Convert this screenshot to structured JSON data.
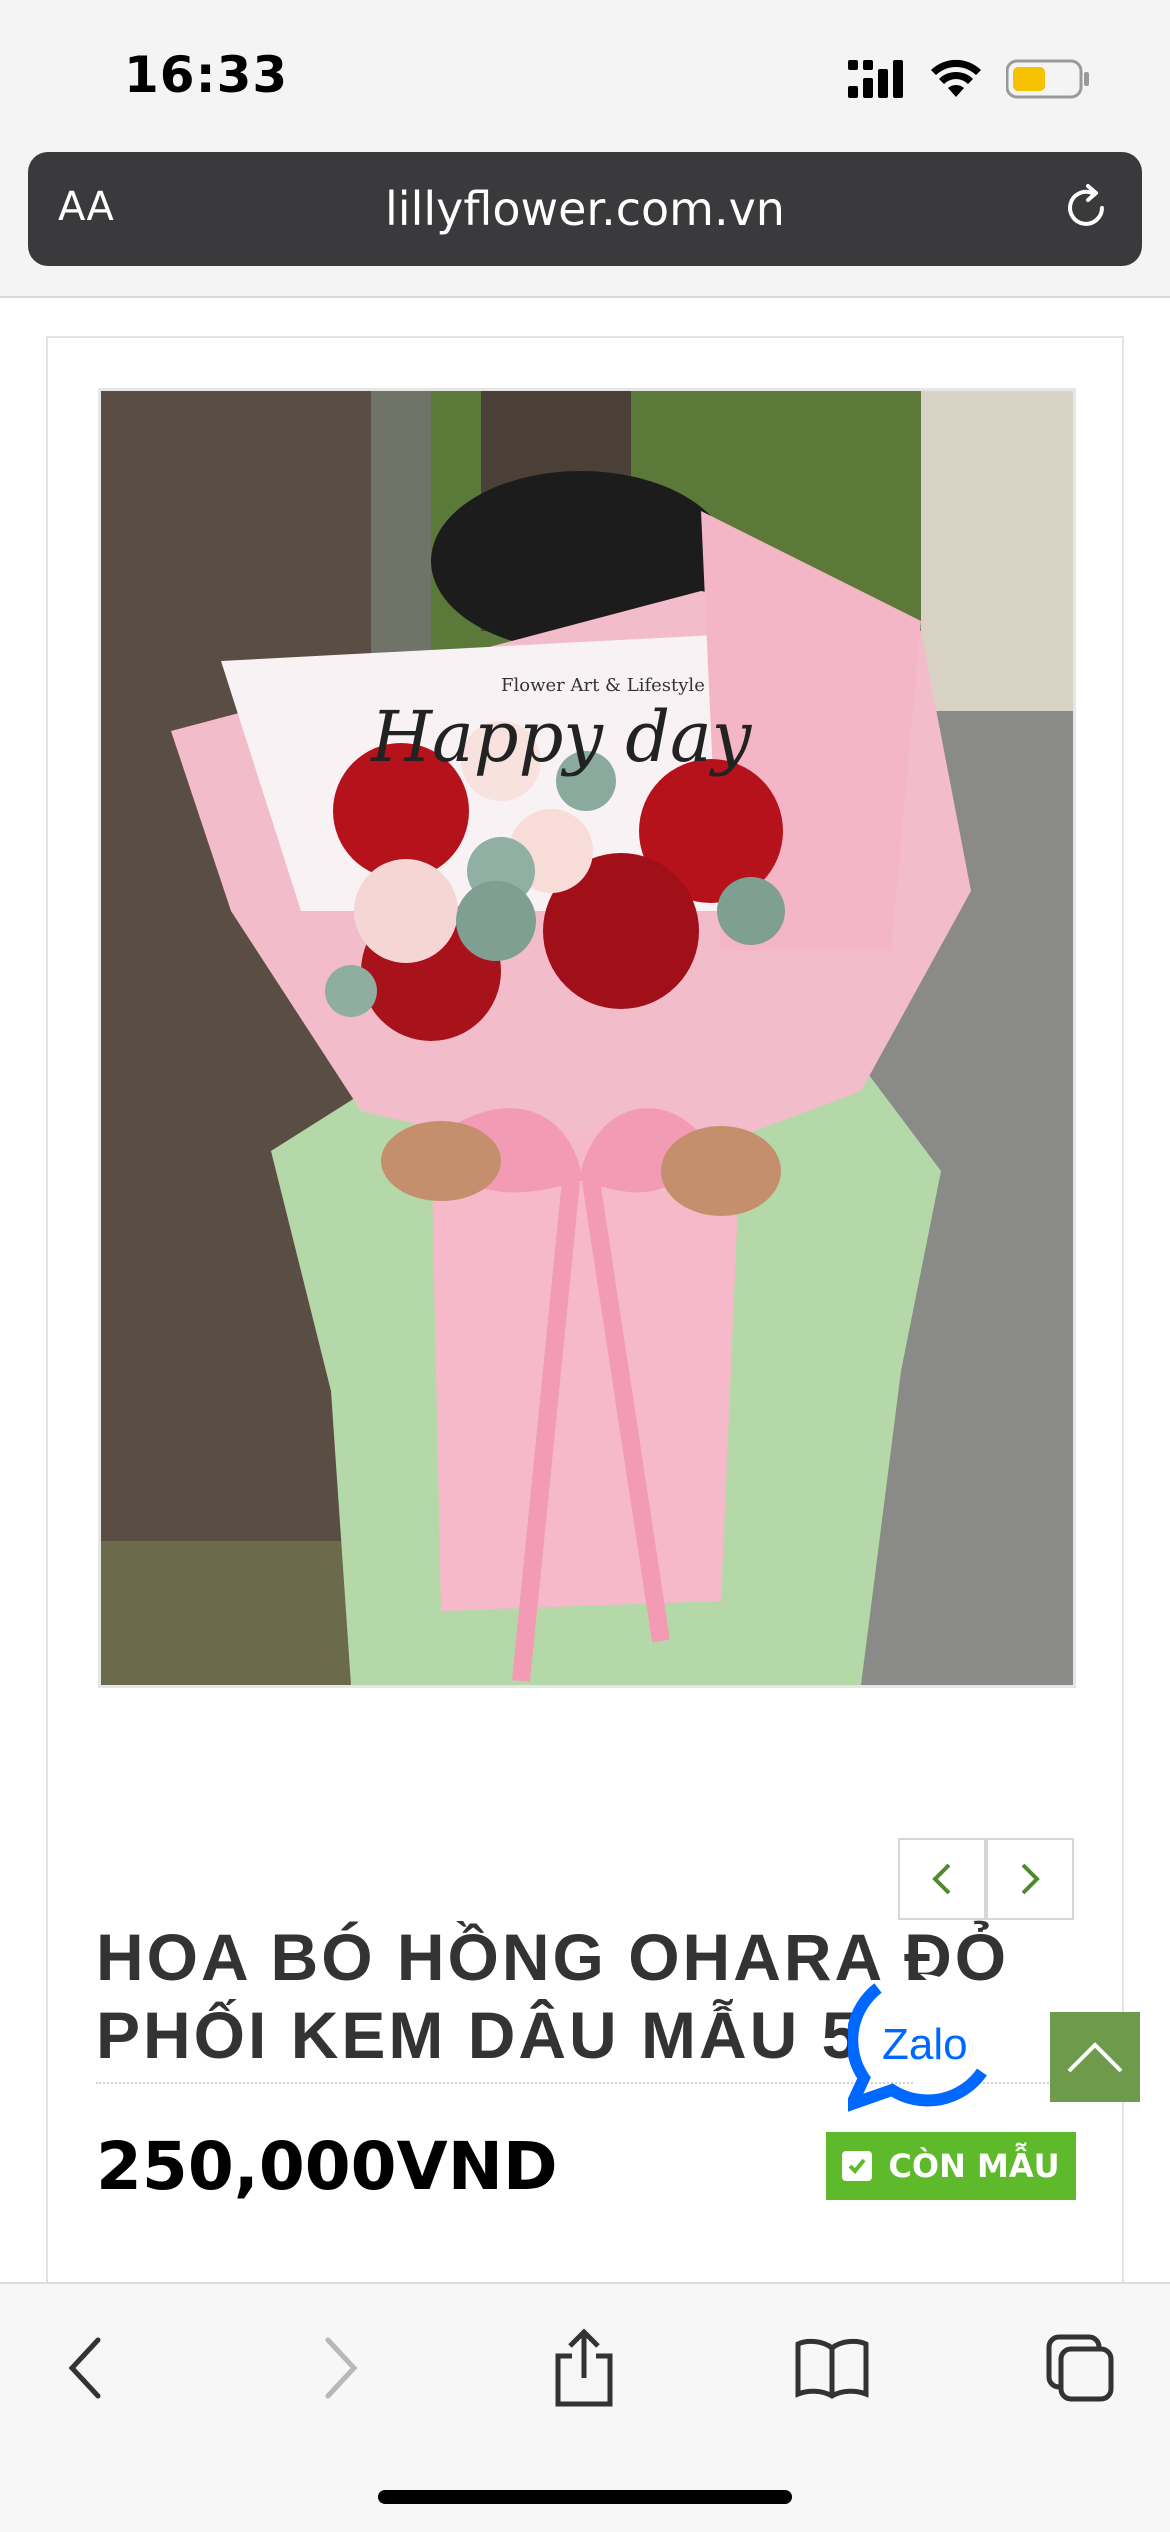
{
  "status_bar": {
    "time": "16:33"
  },
  "browser": {
    "text_size_label": "AA",
    "url": "lillyflower.com.vn"
  },
  "product": {
    "image_card_text_1": "Flower Art & Lifestyle",
    "image_card_text_2": "Happy day",
    "title": "HOA BÓ HỒNG OHARA ĐỎ PHỐI KEM DÂU MẪU 5",
    "price": "250,000VND",
    "stock_label": "CÒN MẪU"
  },
  "floating": {
    "zalo_label": "Zalo"
  },
  "colors": {
    "stock_badge": "#5eb92b",
    "back_to_top": "#6e9b4b",
    "wrap_pink": "#f4b8c8",
    "rose_red": "#b5121b",
    "zalo_blue": "#0068ff"
  }
}
